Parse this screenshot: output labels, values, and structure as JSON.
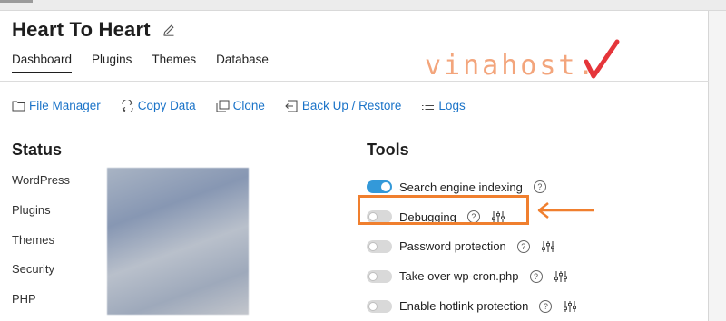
{
  "site": {
    "title": "Heart To Heart"
  },
  "tabs": [
    "Dashboard",
    "Plugins",
    "Themes",
    "Database"
  ],
  "actions": [
    {
      "label": "File Manager",
      "icon": "folder-icon"
    },
    {
      "label": "Copy Data",
      "icon": "copy-data-icon"
    },
    {
      "label": "Clone",
      "icon": "clone-icon"
    },
    {
      "label": "Back Up / Restore",
      "icon": "backup-restore-icon"
    },
    {
      "label": "Logs",
      "icon": "logs-icon"
    }
  ],
  "status": {
    "heading": "Status",
    "items": [
      "WordPress",
      "Plugins",
      "Themes",
      "Security",
      "PHP"
    ]
  },
  "tools": {
    "heading": "Tools",
    "items": [
      {
        "label": "Search engine indexing",
        "enabled": true,
        "has_settings": false
      },
      {
        "label": "Debugging",
        "enabled": false,
        "has_settings": true
      },
      {
        "label": "Password protection",
        "enabled": false,
        "has_settings": true
      },
      {
        "label": "Take over wp-cron.php",
        "enabled": false,
        "has_settings": true
      },
      {
        "label": "Enable hotlink protection",
        "enabled": false,
        "has_settings": true
      }
    ]
  },
  "watermark": {
    "text": "vinahost."
  },
  "colors": {
    "link": "#1a73c8",
    "toggle_on": "#3399d9",
    "highlight": "#f07f2e"
  }
}
